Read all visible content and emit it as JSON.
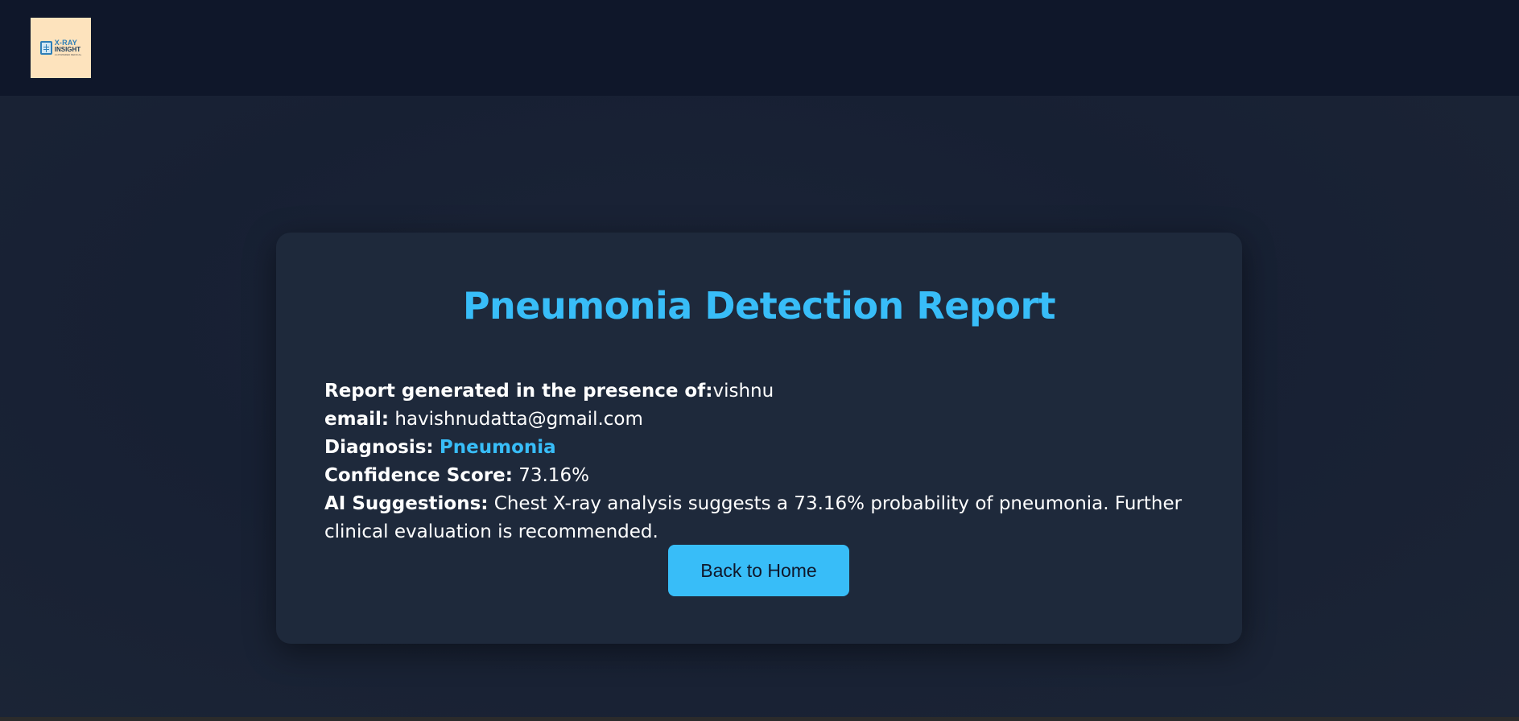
{
  "logo": {
    "line1": "X-RAY",
    "line2": "INSIGHT",
    "line3": "AI-POWERED MEDICAL"
  },
  "report": {
    "title": "Pneumonia Detection Report",
    "presence_label": "Report generated in the presence of:",
    "presence_value": "vishnu",
    "email_label": "email:",
    "email_value": "havishnudatta@gmail.com",
    "diagnosis_label": "Diagnosis:",
    "diagnosis_value": "Pneumonia",
    "confidence_label": "Confidence Score:",
    "confidence_value": "73.16%",
    "suggestions_label": "AI Suggestions:",
    "suggestions_value": "Chest X-ray analysis suggests a 73.16% probability of pneumonia. Further clinical evaluation is recommended."
  },
  "actions": {
    "back_home_label": "Back to Home"
  },
  "colors": {
    "accent": "#38bdf8",
    "card": "#1e293b",
    "topbar": "#0f172a"
  }
}
